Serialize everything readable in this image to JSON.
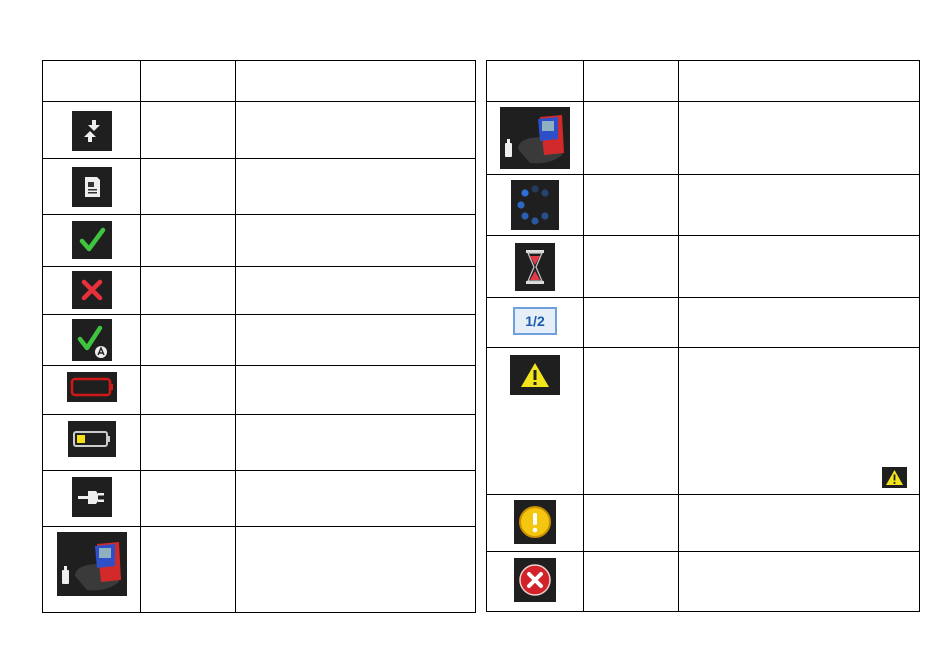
{
  "left_table": {
    "header": [
      "",
      "",
      ""
    ],
    "rows": [
      {
        "icon": "sync-arrows-icon",
        "col2": "",
        "col3": ""
      },
      {
        "icon": "document-icon",
        "col2": "",
        "col3": ""
      },
      {
        "icon": "checkmark-icon",
        "col2": "",
        "col3": ""
      },
      {
        "icon": "cross-icon",
        "col2": "",
        "col3": ""
      },
      {
        "icon": "checkmark-auto-icon",
        "col2": "",
        "col3": ""
      },
      {
        "icon": "battery-empty-icon",
        "col2": "",
        "col3": ""
      },
      {
        "icon": "battery-low-icon",
        "col2": "",
        "col3": ""
      },
      {
        "icon": "power-plug-icon",
        "col2": "",
        "col3": ""
      },
      {
        "icon": "device-adapter-icon",
        "col2": "",
        "col3": ""
      }
    ]
  },
  "right_table": {
    "header": [
      "",
      "",
      ""
    ],
    "rows": [
      {
        "icon": "device-adapter-icon",
        "col2": "",
        "col3": ""
      },
      {
        "icon": "loading-spinner-icon",
        "col2": "",
        "col3": ""
      },
      {
        "icon": "hourglass-icon",
        "col2": "",
        "col3": ""
      },
      {
        "icon": "page-counter-icon",
        "label": "1/2",
        "col2": "",
        "col3": ""
      },
      {
        "icon": "warning-triangle-icon",
        "col2": "",
        "col3": ""
      },
      {
        "icon": "info-exclamation-icon",
        "col2": "",
        "col3": ""
      },
      {
        "icon": "error-circle-icon",
        "col2": "",
        "col3": ""
      }
    ]
  },
  "colors": {
    "icon_background": "#1f1f1f",
    "check_green": "#3ec43e",
    "cross_red": "#e8303a",
    "battery_red": "#d01818",
    "battery_yellow": "#f5e11a",
    "spinner_blue": "#2f6fd6",
    "warning_yellow": "#f2e51c",
    "info_yellow": "#f5c60f",
    "error_red": "#d2232a",
    "device_red": "#d22a2a",
    "device_blue": "#2d50c8"
  }
}
